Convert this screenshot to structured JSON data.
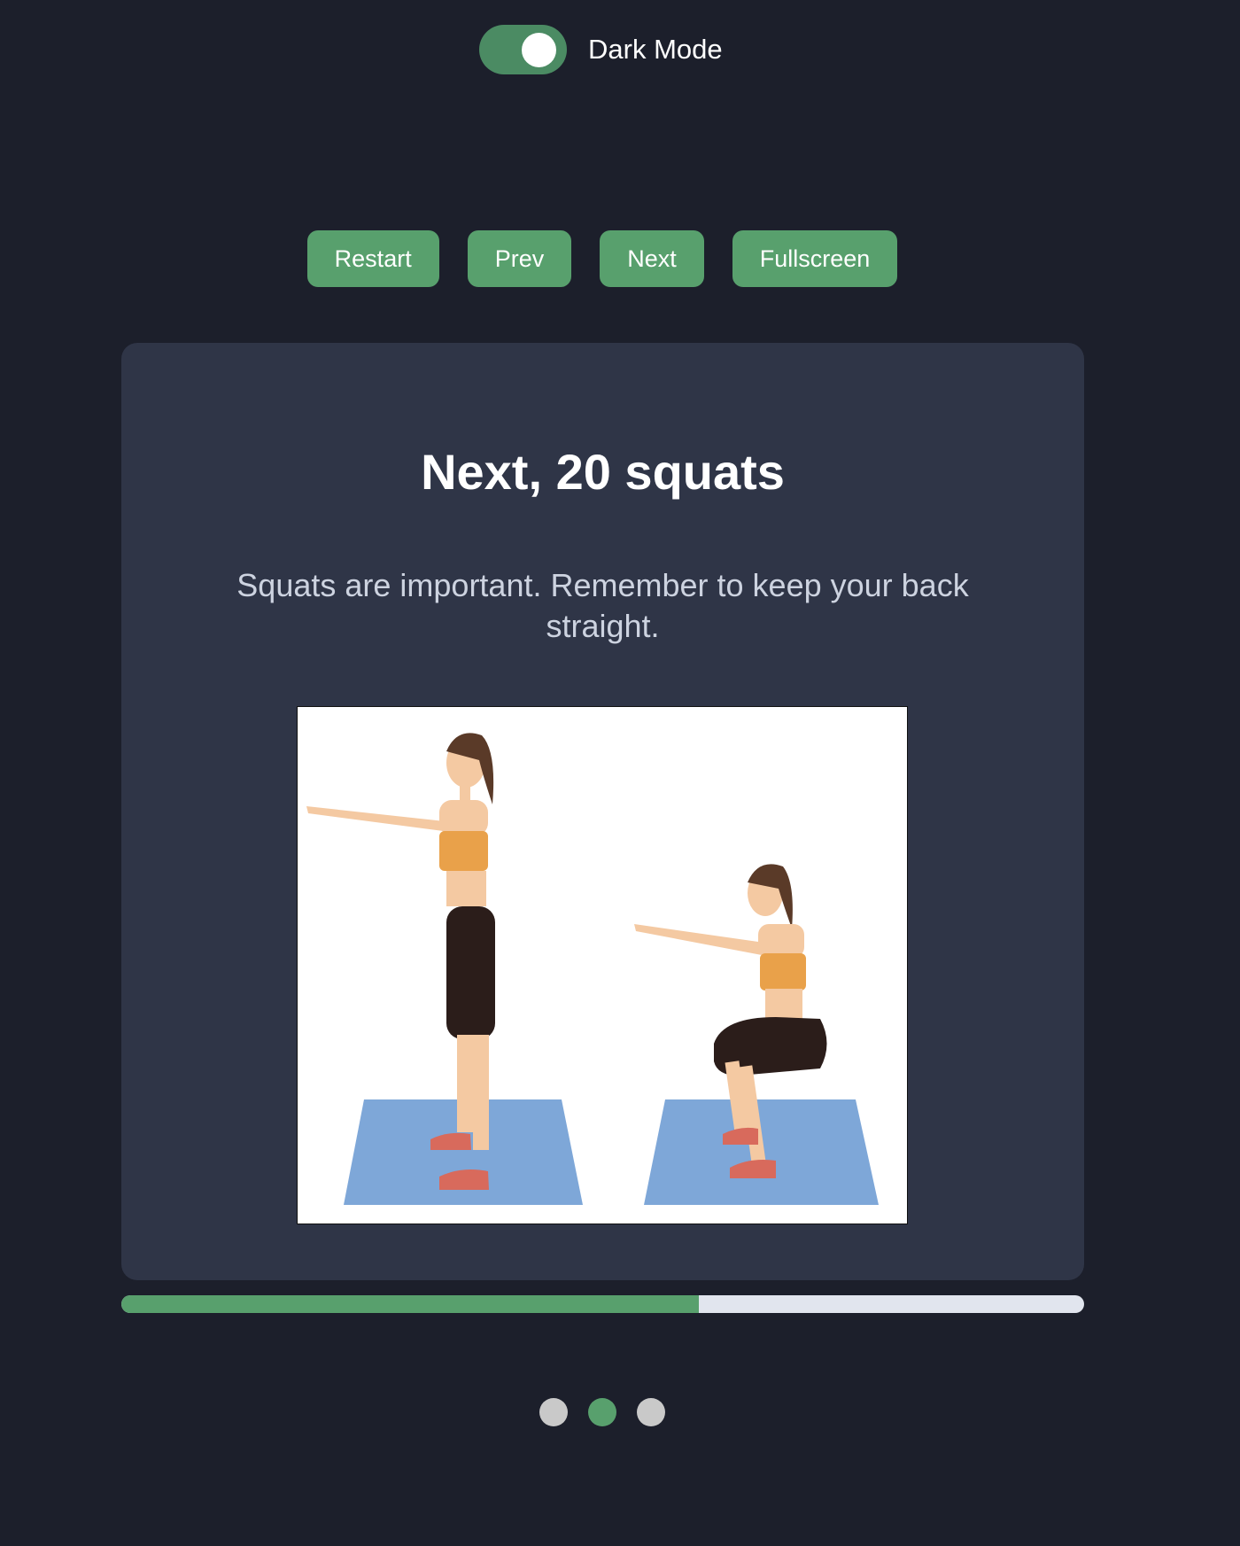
{
  "toggle": {
    "label": "Dark Mode",
    "on": true
  },
  "controls": {
    "restart": "Restart",
    "prev": "Prev",
    "next": "Next",
    "fullscreen": "Fullscreen"
  },
  "slide": {
    "title": "Next, 20 squats",
    "description": "Squats are important. Remember to keep your back straight."
  },
  "progress": {
    "fraction": 0.6
  },
  "pagination": {
    "count": 3,
    "active_index": 1
  },
  "colors": {
    "accent": "#58a06d",
    "background": "#1c1f2b",
    "card": "#2f3547",
    "dot_inactive": "#c9c9c9"
  }
}
